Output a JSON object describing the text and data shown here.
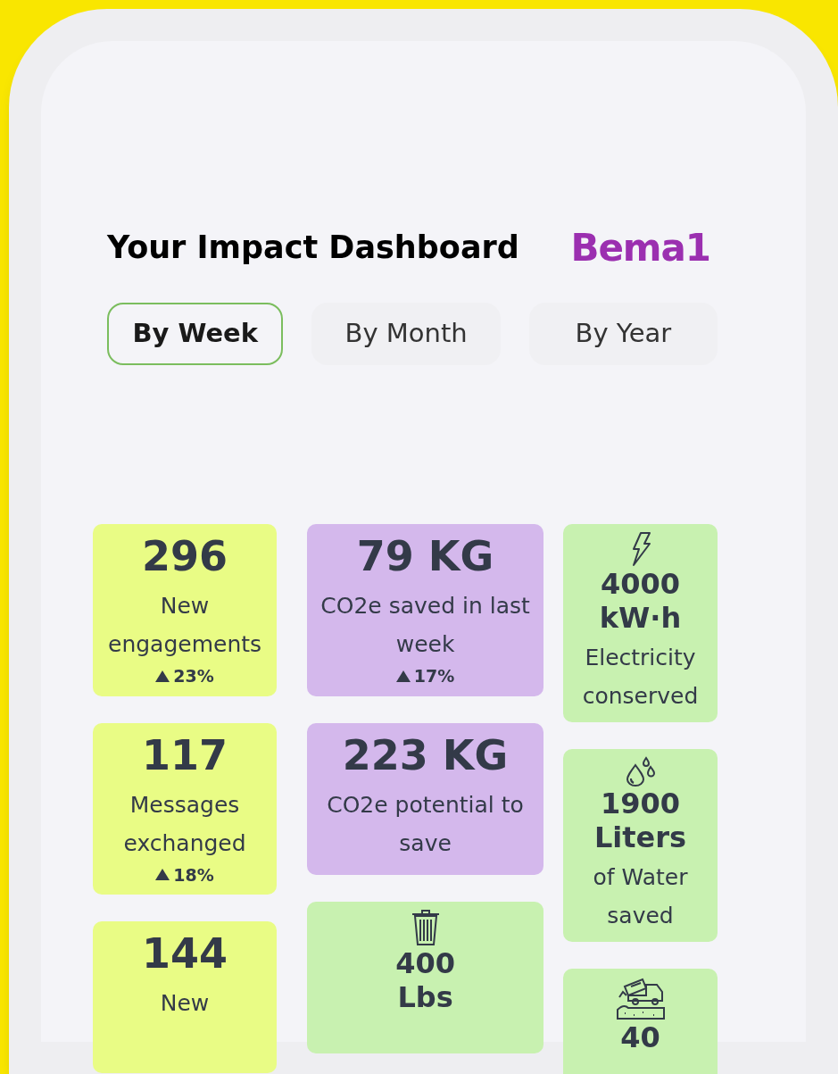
{
  "header": {
    "title": "Your Impact Dashboard",
    "logo": "Bema1"
  },
  "tabs": [
    {
      "label": "By Week",
      "selected": true
    },
    {
      "label": "By Month",
      "selected": false
    },
    {
      "label": "By Year",
      "selected": false
    }
  ],
  "columns": [
    [
      {
        "kind": "plain",
        "color": "#e9fc85",
        "value": "296",
        "label": "New engagements",
        "change": "23%"
      },
      {
        "kind": "plain",
        "color": "#e9fc85",
        "value": "117",
        "label": "Messages exchanged",
        "change": "18%"
      },
      {
        "kind": "plain",
        "color": "#e9fc85",
        "value": "144",
        "label": "New"
      }
    ],
    [
      {
        "kind": "plain",
        "color": "#d4b8ec",
        "value": "79 KG",
        "label": "CO2e saved in last week",
        "change": "17%"
      },
      {
        "kind": "plain",
        "color": "#d4b8ec",
        "value": "223 KG",
        "label": "CO2e potential to save"
      },
      {
        "kind": "waste",
        "color": "#c8f1b0",
        "value": "400",
        "unit": "Lbs"
      }
    ],
    [
      {
        "kind": "energy",
        "color": "#c8f1b0",
        "value": "4000",
        "unit": "kW·h",
        "label": "Electricity conserved"
      },
      {
        "kind": "water",
        "color": "#c8f1b0",
        "value": "1900",
        "unit": "Liters",
        "label": "of Water saved"
      },
      {
        "kind": "landfill",
        "color": "#c8f1b0",
        "value": "40"
      }
    ]
  ]
}
